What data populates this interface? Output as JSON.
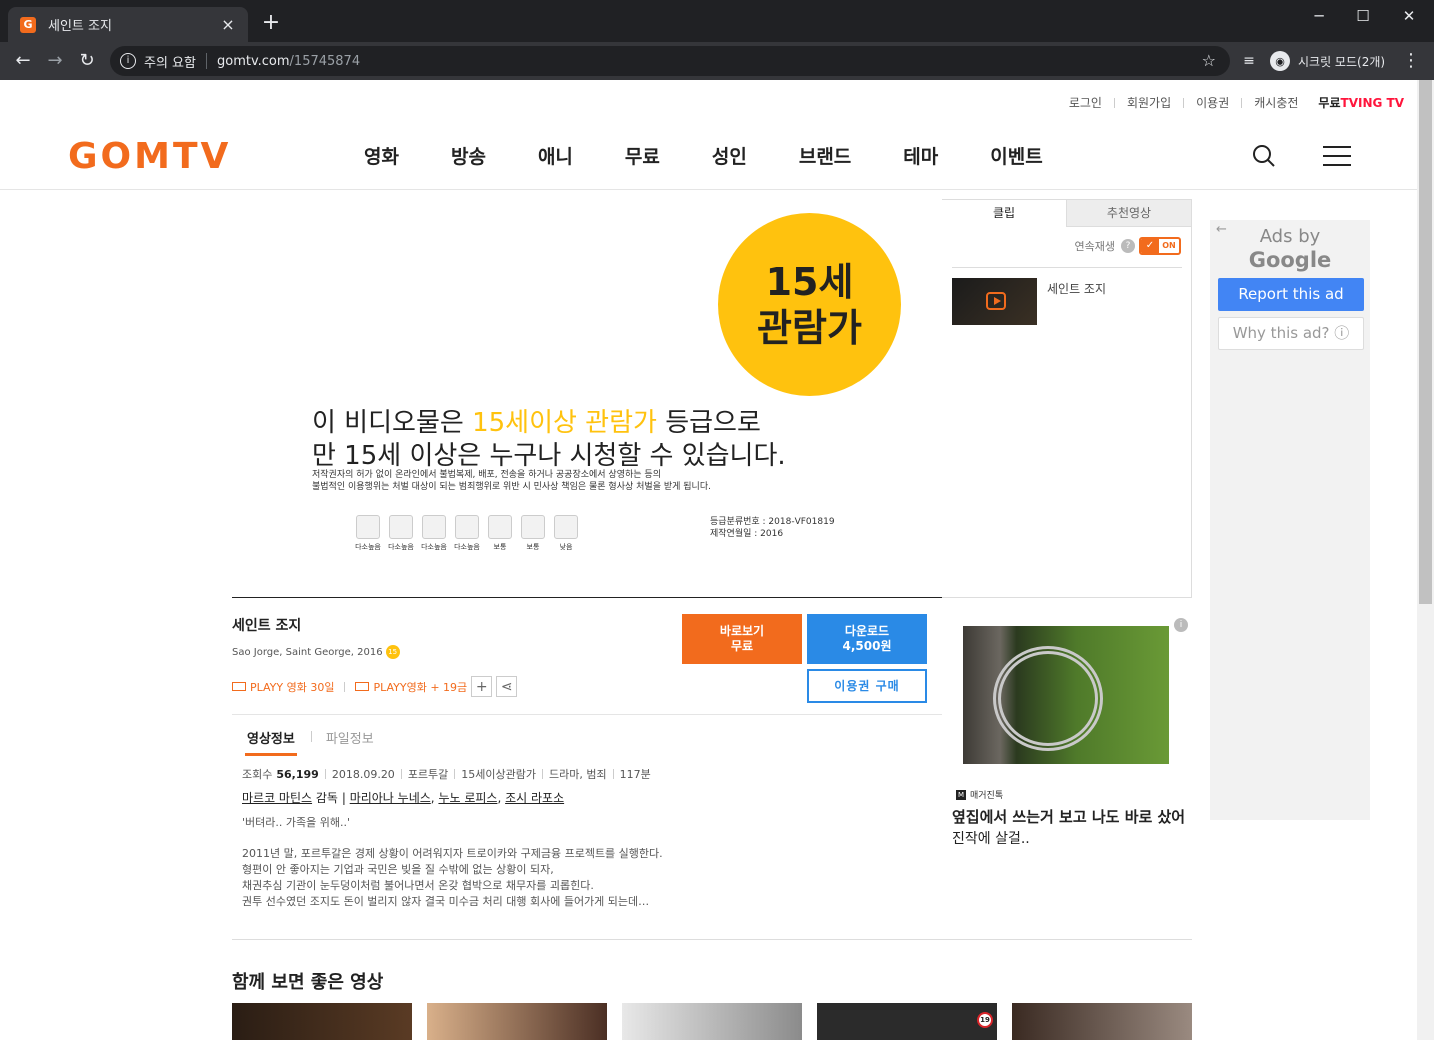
{
  "browser": {
    "tab_title": "세인트 조지",
    "tab_favicon_letter": "G",
    "security_label": "주의 요함",
    "url_host": "gomtv.com",
    "url_path": "/15745874",
    "incognito_label": "시크릿 모드(2개)",
    "new_tab_glyph": "+",
    "close_glyph": "×"
  },
  "header": {
    "util_links": [
      "로그인",
      "회원가입",
      "이용권",
      "캐시충전"
    ],
    "tving_prefix": "무료",
    "tving_brand": "TVING TV",
    "logo": "GOMTV",
    "nav": [
      "영화",
      "방송",
      "애니",
      "무료",
      "성인",
      "브랜드",
      "테마",
      "이벤트"
    ]
  },
  "player": {
    "rating_circle_top": "15세",
    "rating_circle_bottom": "관람가",
    "line1_prefix": "이 비디오물은",
    "line1_highlight": "15세이상 관람가",
    "line1_suffix": "등급으로",
    "line2": "만 15세 이상은 누구나 시청할 수 있습니다.",
    "note1": "저작권자의 허가 없이 온라인에서 불법복제, 배포, 전송을 하거나 공공장소에서 상영하는 등의",
    "note2": "불법적인 이용행위는 처벌 대상이 되는 범죄행위로 위반 시 민사상 책임은 물론 형사상 처벌을 받게 됩니다.",
    "icon_labels": [
      "다소높음",
      "다소높음",
      "다소높음",
      "다소높음",
      "보통",
      "보통",
      "낮음"
    ],
    "meta1": "등급분류번호 : 2018-VF01819",
    "meta2": "제작연월일 : 2016"
  },
  "playlist": {
    "tabs": [
      "클립",
      "추천영상"
    ],
    "autoplay_label": "연속재생",
    "help_glyph": "?",
    "toggle_label": "ON",
    "item_title": "세인트 조지"
  },
  "side_ad": {
    "ads_by": "Ads by",
    "google": "Google",
    "report": "Report this ad",
    "why": "Why this ad? ⓘ"
  },
  "movie": {
    "title": "세인트 조지",
    "subtitle": "Sao Jorge, Saint George, 2016",
    "age_badge": "15",
    "passes": [
      "PLAYY 영화 30일",
      "PLAYY영화 + 19금"
    ],
    "watch_line1": "바로보기",
    "watch_line2": "무료",
    "download_line1": "다운로드",
    "download_line2": "4,500원",
    "pass_buy": "이용권 구매"
  },
  "info": {
    "tabs": [
      "영상정보",
      "파일정보"
    ],
    "views_label": "조회수",
    "views": "56,199",
    "meta": [
      "2018.09.20",
      "포르투갈",
      "15세이상관람가",
      "드라마, 범죄",
      "117분"
    ],
    "director": "마르코 마틴스",
    "director_suffix": "감독",
    "cast": [
      "마리아나 누네스",
      "누노 로피스",
      "조시 라포소"
    ],
    "tagline": "'버텨라.. 가족을 위해..'",
    "synopsis": [
      "2011년 말, 포르투갈은 경제 상황이 어려워지자 트로이카와 구제금융 프로젝트를 실행한다.",
      "형편이 안 좋아지는 기업과 국민은 빚을 질 수밖에 없는 상황이 되자,",
      "채권추심 기관이 눈두덩이처럼 불어나면서 온갖 협박으로 채무자를 괴롭힌다.",
      "권투 선수였던 조지도 돈이 벌리지 않자 결국 미수금 처리 대행 회사에 들어가게 되는데…"
    ]
  },
  "right_ad": {
    "info_glyph": "i",
    "brand_logo": "M",
    "brand": "매거진톡",
    "headline": "옆집에서 쓰는거 보고 나도 바로 샀어",
    "body": "진작에 살걸.."
  },
  "related": {
    "title": "함께 보면 좋은 영상",
    "badge": "19"
  }
}
